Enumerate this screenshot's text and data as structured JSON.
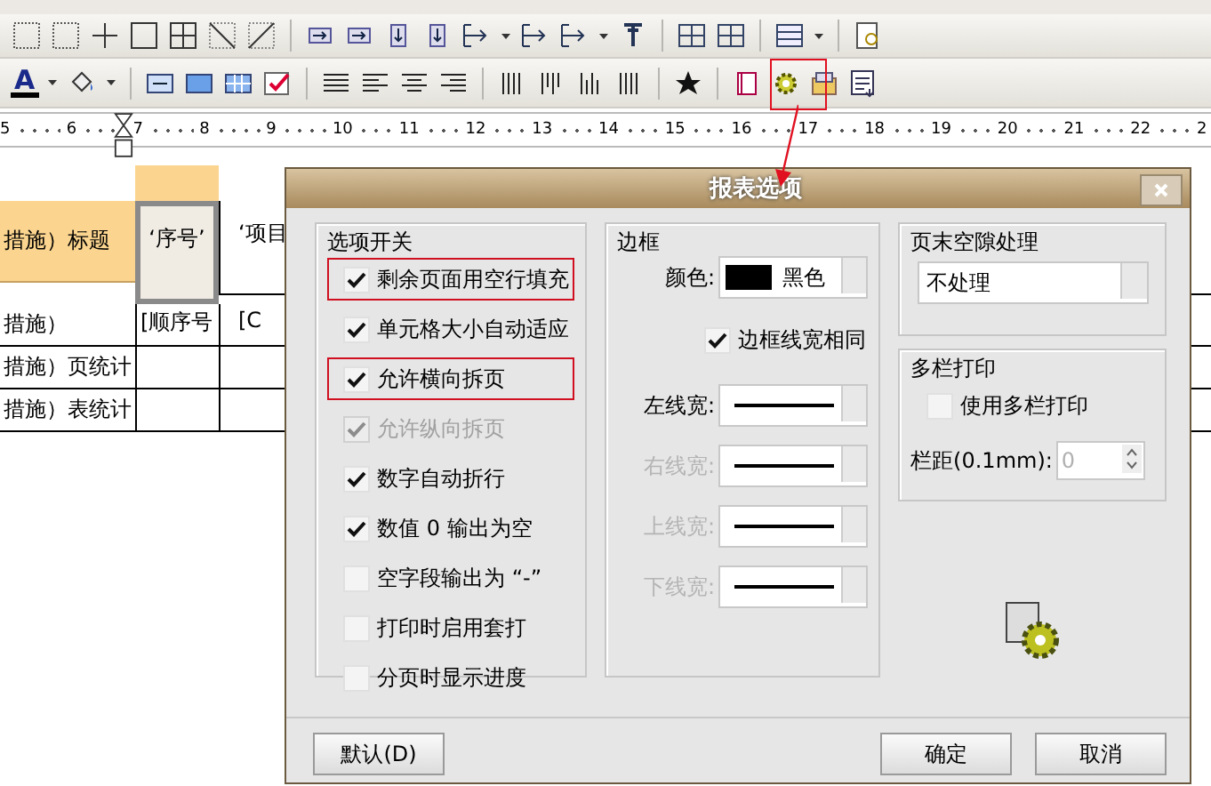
{
  "toolbar_format": {
    "font_color_glyph": "A"
  },
  "ruler": {
    "labels": [
      "5",
      "6",
      "7",
      "8",
      "9",
      "10",
      "11",
      "12",
      "13",
      "14",
      "15",
      "16",
      "17",
      "18",
      "19",
      "20",
      "21",
      "22",
      "2"
    ]
  },
  "sheet": {
    "rows": [
      {
        "label": "措施）标题",
        "header": true,
        "cells": [
          {
            "text": "‘序号’",
            "selected": true
          },
          {
            "text": "‘项目",
            "selected": false
          }
        ]
      },
      {
        "label": "措施）",
        "header": false,
        "cells": [
          {
            "text": "[顺序号",
            "selected": false
          },
          {
            "text": "[C",
            "selected": false
          }
        ]
      },
      {
        "label": "措施）页统计",
        "header": false,
        "cells": [
          {
            "text": "",
            "selected": false
          },
          {
            "text": "",
            "selected": false
          }
        ]
      },
      {
        "label": "措施）表统计",
        "header": false,
        "cells": [
          {
            "text": "",
            "selected": false
          },
          {
            "text": "",
            "selected": false
          }
        ]
      }
    ]
  },
  "dialog": {
    "title": "报表选项",
    "options_group": {
      "title": "选项开关",
      "items": [
        {
          "label": "剩余页面用空行填充",
          "checked": true,
          "disabled": false,
          "annotated": true
        },
        {
          "label": "单元格大小自动适应",
          "checked": true,
          "disabled": false,
          "annotated": false
        },
        {
          "label": "允许横向拆页",
          "checked": true,
          "disabled": false,
          "annotated": true
        },
        {
          "label": "允许纵向拆页",
          "checked": true,
          "disabled": true,
          "annotated": false
        },
        {
          "label": "数字自动折行",
          "checked": true,
          "disabled": false,
          "annotated": false
        },
        {
          "label": "数值 0 输出为空",
          "checked": true,
          "disabled": false,
          "annotated": false
        },
        {
          "label": "空字段输出为 “-”",
          "checked": false,
          "disabled": false,
          "annotated": false
        },
        {
          "label": "打印时启用套打",
          "checked": false,
          "disabled": false,
          "annotated": false
        },
        {
          "label": "分页时显示进度",
          "checked": false,
          "disabled": false,
          "annotated": false
        }
      ]
    },
    "border_group": {
      "title": "边框",
      "color_label": "颜色:",
      "color_value": "黑色",
      "same_width": {
        "label": "边框线宽相同",
        "checked": true
      },
      "width_fields": [
        {
          "label": "左线宽:",
          "disabled": false
        },
        {
          "label": "右线宽:",
          "disabled": true
        },
        {
          "label": "上线宽:",
          "disabled": true
        },
        {
          "label": "下线宽:",
          "disabled": true
        }
      ]
    },
    "page_end_group": {
      "title": "页末空隙处理",
      "value": "不处理"
    },
    "multi_column_group": {
      "title": "多栏打印",
      "use": {
        "label": "使用多栏打印",
        "checked": false
      },
      "spacing": {
        "label": "栏距(0.1mm):",
        "value": "0",
        "disabled": true
      }
    },
    "buttons": [
      {
        "label": "默认(D)",
        "kind": "left"
      },
      {
        "label": "确定",
        "kind": "right"
      },
      {
        "label": "取消",
        "kind": "right"
      }
    ]
  }
}
